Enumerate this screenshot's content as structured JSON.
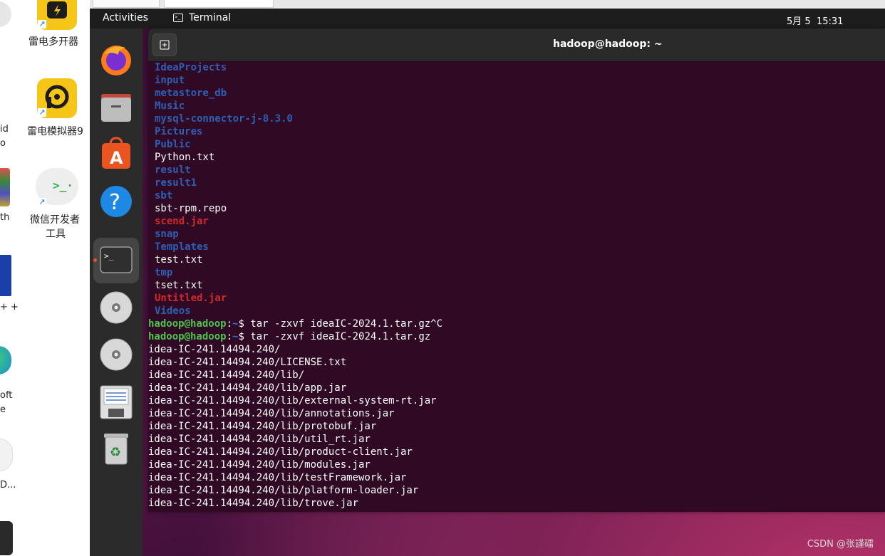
{
  "host_desktop": {
    "icons": [
      {
        "label": "雷电多开器",
        "icon": "leidian-multi-icon"
      },
      {
        "label": "雷电模拟器9",
        "icon": "leidian-emulator-icon"
      },
      {
        "label_line1": "微信开发者",
        "label_line2": "工具",
        "icon": "wechat-devtools-icon"
      }
    ],
    "clipped_labels": [
      "id",
      "o",
      "th",
      "+ +",
      "oft",
      "e",
      "D..."
    ]
  },
  "vm": {
    "topbar": {
      "activities": "Activities",
      "app_label": "Terminal",
      "clock": "5月 5  15:31"
    },
    "dock": [
      {
        "name": "firefox-icon"
      },
      {
        "name": "files-icon"
      },
      {
        "name": "app-center-icon"
      },
      {
        "name": "help-icon"
      },
      {
        "name": "terminal-icon",
        "active": true
      },
      {
        "name": "disc-drive-icon"
      },
      {
        "name": "disc-drive-icon"
      },
      {
        "name": "floppy-save-icon"
      },
      {
        "name": "trash-icon"
      }
    ]
  },
  "terminal": {
    "title": "hadoop@hadoop: ~",
    "listing": [
      {
        "text": "IdeaProjects",
        "kind": "dir"
      },
      {
        "text": "input",
        "kind": "dir"
      },
      {
        "text": "metastore_db",
        "kind": "dir"
      },
      {
        "text": "Music",
        "kind": "dir"
      },
      {
        "text": "mysql-connector-j-8.3.0",
        "kind": "dir"
      },
      {
        "text": "Pictures",
        "kind": "dir"
      },
      {
        "text": "Public",
        "kind": "dir"
      },
      {
        "text": "Python.txt",
        "kind": "file"
      },
      {
        "text": "result",
        "kind": "dir"
      },
      {
        "text": "result1",
        "kind": "dir"
      },
      {
        "text": "sbt",
        "kind": "dir"
      },
      {
        "text": "sbt-rpm.repo",
        "kind": "file"
      },
      {
        "text": "scend.jar",
        "kind": "jar"
      },
      {
        "text": "snap",
        "kind": "dir"
      },
      {
        "text": "Templates",
        "kind": "dir"
      },
      {
        "text": "test.txt",
        "kind": "file"
      },
      {
        "text": "tmp",
        "kind": "dir"
      },
      {
        "text": "tset.txt",
        "kind": "file"
      },
      {
        "text": "Untitled.jar",
        "kind": "jar"
      },
      {
        "text": "Videos",
        "kind": "dir"
      }
    ],
    "commands": [
      {
        "user": "hadoop@hadoop",
        "colon": ":",
        "path": "~",
        "sign": "$ ",
        "cmd": "tar -zxvf ideaIC-2024.1.tar.gz^C"
      },
      {
        "user": "hadoop@hadoop",
        "colon": ":",
        "path": "~",
        "sign": "$ ",
        "cmd": "tar -zxvf ideaIC-2024.1.tar.gz"
      }
    ],
    "output": [
      "idea-IC-241.14494.240/",
      "idea-IC-241.14494.240/LICENSE.txt",
      "idea-IC-241.14494.240/lib/",
      "idea-IC-241.14494.240/lib/app.jar",
      "idea-IC-241.14494.240/lib/external-system-rt.jar",
      "idea-IC-241.14494.240/lib/annotations.jar",
      "idea-IC-241.14494.240/lib/protobuf.jar",
      "idea-IC-241.14494.240/lib/util_rt.jar",
      "idea-IC-241.14494.240/lib/product-client.jar",
      "idea-IC-241.14494.240/lib/modules.jar",
      "idea-IC-241.14494.240/lib/testFramework.jar",
      "idea-IC-241.14494.240/lib/platform-loader.jar",
      "idea-IC-241.14494.240/lib/trove.jar"
    ]
  },
  "watermark": "CSDN @张謹礌",
  "colors": {
    "terminal_bg": "#300a24",
    "dir": "#2d5fb4",
    "jar": "#d12a2a",
    "prompt": "#4fc44f"
  }
}
